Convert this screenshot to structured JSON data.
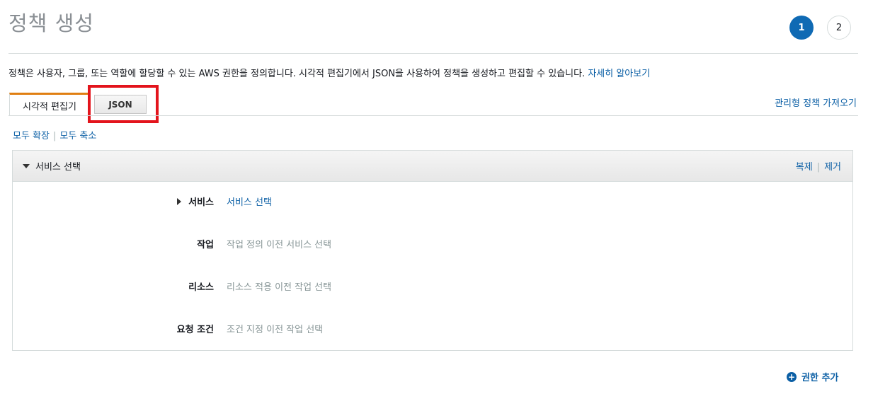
{
  "page": {
    "title": "정책 생성",
    "steps": [
      "1",
      "2"
    ]
  },
  "description": {
    "text": "정책은 사용자, 그룹, 또는 역할에 할당할 수 있는 AWS 권한을 정의합니다. 시각적 편집기에서 JSON을 사용하여 정책을 생성하고 편집할 수 있습니다.",
    "link": "자세히 알아보기"
  },
  "tabs": {
    "visual": "시각적 편집기",
    "json": "JSON",
    "import_link": "관리형 정책 가져오기"
  },
  "expand": {
    "expand_all": "모두 확장",
    "collapse_all": "모두 축소"
  },
  "panel": {
    "header_title": "서비스 선택",
    "duplicate": "복제",
    "remove": "제거",
    "rows": [
      {
        "label": "서비스",
        "value": "서비스 선택"
      },
      {
        "label": "작업",
        "value": "작업 정의 이전 서비스 선택"
      },
      {
        "label": "리소스",
        "value": "리소스 적용 이전 작업 선택"
      },
      {
        "label": "요청 조건",
        "value": "조건 지정 이전 작업 선택"
      }
    ]
  },
  "footer": {
    "add_permission": "권한 추가"
  },
  "colors": {
    "accent": "#0f6ab4",
    "link": "#0b5fa5",
    "tab_active": "#e07f12",
    "highlight": "#e3141c"
  }
}
